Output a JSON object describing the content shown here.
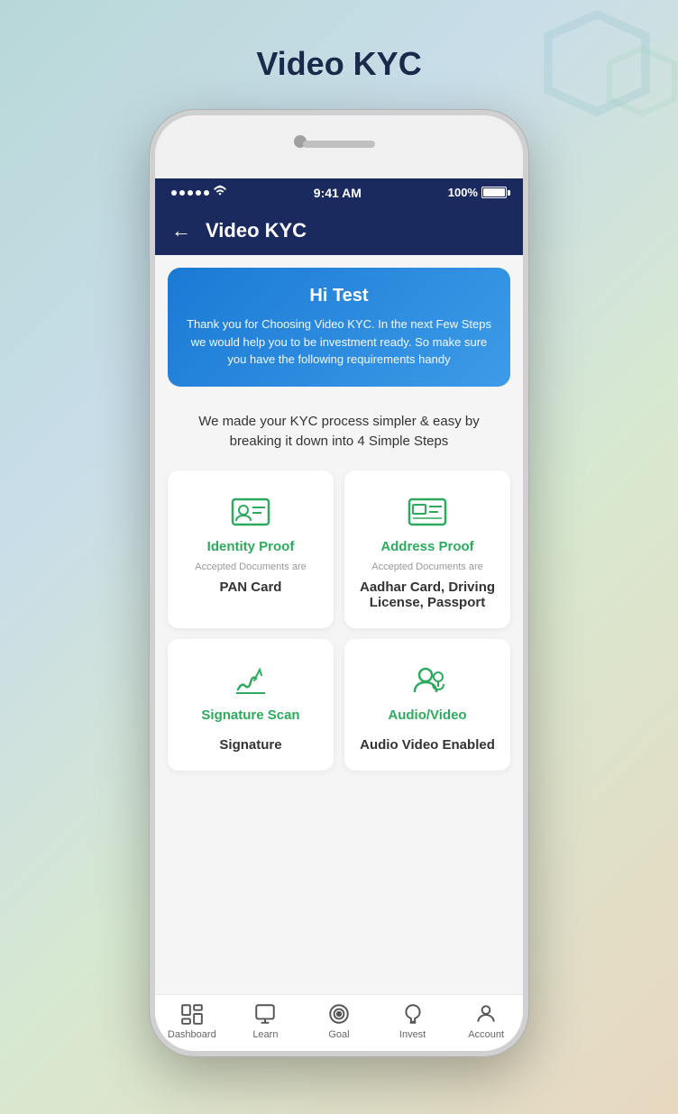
{
  "page": {
    "title": "Video KYC",
    "background": "gradient"
  },
  "status_bar": {
    "time": "9:41 AM",
    "battery": "100%",
    "signal": "●●●●●",
    "wifi": "wifi"
  },
  "header": {
    "back_label": "←",
    "title": "Video KYC"
  },
  "welcome": {
    "greeting": "Hi Test",
    "description": "Thank you for Choosing Video KYC. In the next Few Steps we would help you to be investment ready. So make sure you have the following requirements handy"
  },
  "steps_text": "We made your KYC process simpler & easy by breaking it down into 4 Simple Steps",
  "cards": [
    {
      "id": "identity-proof",
      "title": "Identity Proof",
      "subtitle": "Accepted Documents are",
      "value": "PAN Card",
      "icon": "id-card-icon"
    },
    {
      "id": "address-proof",
      "title": "Address Proof",
      "subtitle": "Accepted Documents are",
      "value": "Aadhar Card, Driving License, Passport",
      "icon": "address-card-icon"
    },
    {
      "id": "signature-scan",
      "title": "Signature Scan",
      "subtitle": "",
      "value": "Signature",
      "icon": "signature-icon"
    },
    {
      "id": "audio-video",
      "title": "Audio/Video",
      "subtitle": "",
      "value": "Audio Video Enabled",
      "icon": "av-icon"
    }
  ],
  "bottom_nav": [
    {
      "id": "dashboard",
      "label": "Dashboard",
      "icon": "dashboard-icon"
    },
    {
      "id": "learn",
      "label": "Learn",
      "icon": "learn-icon"
    },
    {
      "id": "goal",
      "label": "Goal",
      "icon": "goal-icon"
    },
    {
      "id": "invest",
      "label": "Invest",
      "icon": "invest-icon"
    },
    {
      "id": "account",
      "label": "Account",
      "icon": "account-icon"
    }
  ]
}
